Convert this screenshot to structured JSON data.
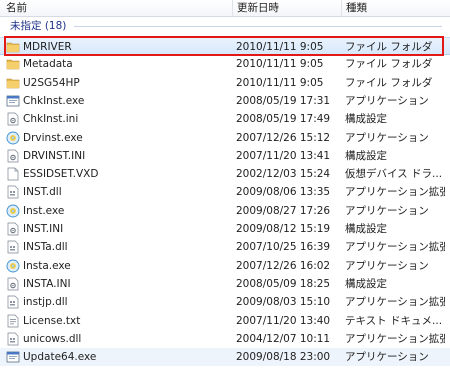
{
  "header": {
    "name": "名前",
    "date": "更新日時",
    "type": "種類"
  },
  "group": {
    "label": "未指定 (18)"
  },
  "files": [
    {
      "name": "MDRIVER",
      "date": "2010/11/11 9:05",
      "type": "ファイル フォルダ",
      "icon": "folder-icon"
    },
    {
      "name": "Metadata",
      "date": "2010/11/11 9:05",
      "type": "ファイル フォルダ",
      "icon": "folder-icon"
    },
    {
      "name": "U2SG54HP",
      "date": "2010/11/11 9:05",
      "type": "ファイル フォルダ",
      "icon": "folder-icon"
    },
    {
      "name": "ChkInst.exe",
      "date": "2008/05/19 17:31",
      "type": "アプリケーション",
      "icon": "exe-window-icon"
    },
    {
      "name": "ChkInst.ini",
      "date": "2008/05/19 17:49",
      "type": "構成設定",
      "icon": "settings-file-icon"
    },
    {
      "name": "Drvinst.exe",
      "date": "2007/12/26 15:12",
      "type": "アプリケーション",
      "icon": "installer-disc-icon"
    },
    {
      "name": "DRVINST.INI",
      "date": "2007/11/20 13:41",
      "type": "構成設定",
      "icon": "settings-file-icon"
    },
    {
      "name": "ESSIDSET.VXD",
      "date": "2002/12/03 15:24",
      "type": "仮想デバイス ドラ...",
      "icon": "generic-file-icon"
    },
    {
      "name": "INST.dll",
      "date": "2009/08/06 13:35",
      "type": "アプリケーション拡張",
      "icon": "dll-file-icon"
    },
    {
      "name": "Inst.exe",
      "date": "2009/08/27 17:26",
      "type": "アプリケーション",
      "icon": "installer-disc-icon"
    },
    {
      "name": "INST.INI",
      "date": "2009/08/12 15:19",
      "type": "構成設定",
      "icon": "settings-file-icon"
    },
    {
      "name": "INSTa.dll",
      "date": "2007/10/25 16:39",
      "type": "アプリケーション拡張",
      "icon": "dll-file-icon"
    },
    {
      "name": "Insta.exe",
      "date": "2007/12/26 16:02",
      "type": "アプリケーション",
      "icon": "installer-disc-icon"
    },
    {
      "name": "INSTA.INI",
      "date": "2008/05/09 18:25",
      "type": "構成設定",
      "icon": "settings-file-icon"
    },
    {
      "name": "instjp.dll",
      "date": "2009/08/03 15:10",
      "type": "アプリケーション拡張",
      "icon": "dll-file-icon"
    },
    {
      "name": "License.txt",
      "date": "2007/11/20 13:40",
      "type": "テキスト ドキュメ...",
      "icon": "text-file-icon"
    },
    {
      "name": "unicows.dll",
      "date": "2004/12/07 10:11",
      "type": "アプリケーション拡張",
      "icon": "dll-file-icon"
    },
    {
      "name": "Update64.exe",
      "date": "2009/08/18 23:00",
      "type": "アプリケーション",
      "icon": "exe-window-icon"
    }
  ],
  "selected_index": 0,
  "hover_index": 17,
  "colors": {
    "highlight_border": "#e41717",
    "group_text": "#1e3287",
    "folder": "#e8b84a"
  }
}
